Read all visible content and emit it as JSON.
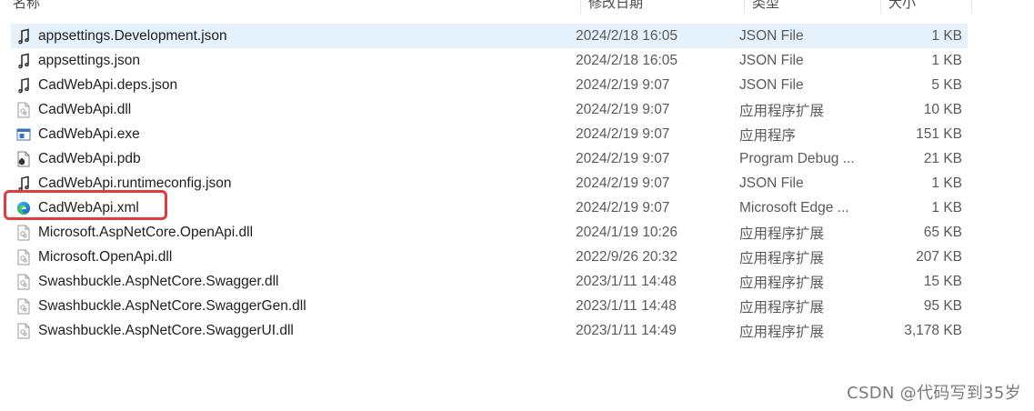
{
  "header": {
    "name": "名称",
    "date": "修改日期",
    "type": "类型",
    "size": "大小"
  },
  "files": [
    {
      "name": "appsettings.Development.json",
      "date": "2024/2/18 16:05",
      "type": "JSON File",
      "size": "1 KB",
      "icon": "json-file-icon"
    },
    {
      "name": "appsettings.json",
      "date": "2024/2/18 16:05",
      "type": "JSON File",
      "size": "1 KB",
      "icon": "json-file-icon"
    },
    {
      "name": "CadWebApi.deps.json",
      "date": "2024/2/19 9:07",
      "type": "JSON File",
      "size": "5 KB",
      "icon": "json-file-icon"
    },
    {
      "name": "CadWebApi.dll",
      "date": "2024/2/19 9:07",
      "type": "应用程序扩展",
      "size": "10 KB",
      "icon": "dll-file-icon"
    },
    {
      "name": "CadWebApi.exe",
      "date": "2024/2/19 9:07",
      "type": "应用程序",
      "size": "151 KB",
      "icon": "exe-file-icon"
    },
    {
      "name": "CadWebApi.pdb",
      "date": "2024/2/19 9:07",
      "type": "Program Debug ...",
      "size": "21 KB",
      "icon": "pdb-file-icon"
    },
    {
      "name": "CadWebApi.runtimeconfig.json",
      "date": "2024/2/19 9:07",
      "type": "JSON File",
      "size": "1 KB",
      "icon": "json-file-icon"
    },
    {
      "name": "CadWebApi.xml",
      "date": "2024/2/19 9:07",
      "type": "Microsoft Edge ...",
      "size": "1 KB",
      "icon": "edge-icon"
    },
    {
      "name": "Microsoft.AspNetCore.OpenApi.dll",
      "date": "2024/1/19 10:26",
      "type": "应用程序扩展",
      "size": "65 KB",
      "icon": "dll-file-icon"
    },
    {
      "name": "Microsoft.OpenApi.dll",
      "date": "2022/9/26 20:32",
      "type": "应用程序扩展",
      "size": "207 KB",
      "icon": "dll-file-icon"
    },
    {
      "name": "Swashbuckle.AspNetCore.Swagger.dll",
      "date": "2023/1/11 14:48",
      "type": "应用程序扩展",
      "size": "15 KB",
      "icon": "dll-file-icon"
    },
    {
      "name": "Swashbuckle.AspNetCore.SwaggerGen.dll",
      "date": "2023/1/11 14:48",
      "type": "应用程序扩展",
      "size": "95 KB",
      "icon": "dll-file-icon"
    },
    {
      "name": "Swashbuckle.AspNetCore.SwaggerUI.dll",
      "date": "2023/1/11 14:49",
      "type": "应用程序扩展",
      "size": "3,178 KB",
      "icon": "dll-file-icon"
    }
  ],
  "watermark": "CSDN @代码写到35岁",
  "colors": {
    "selected_row": "#e5f1fb",
    "highlight_border": "#e23b3b"
  }
}
